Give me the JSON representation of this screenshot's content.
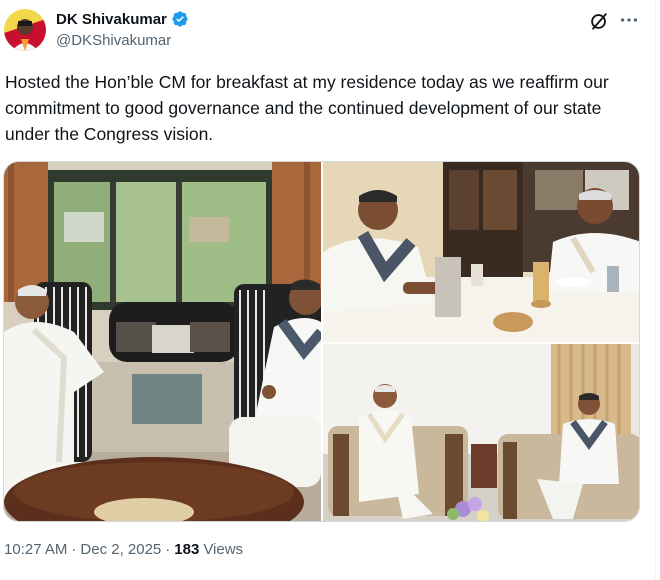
{
  "author": {
    "display_name": "DK Shivakumar",
    "handle": "@DKShivakumar",
    "verified_icon": "verified-badge-icon",
    "avatar": "avatar"
  },
  "actions": {
    "grok_icon": "grok-icon",
    "more_icon": "more-dots-icon"
  },
  "tweet": {
    "text": "Hosted the Hon’ble CM for breakfast at my residence today as we reaffirm our commitment to good governance and the continued development of our state under the Congress vision."
  },
  "media": {
    "count": 3
  },
  "meta": {
    "time": "10:27 AM",
    "separator": "·",
    "date": "Dec 2, 2025",
    "separator2": "·",
    "views_count": "183",
    "views_label": "Views"
  },
  "colors": {
    "text": "#0f1419",
    "secondary": "#536471",
    "verified": "#1d9bf0",
    "border": "#cfd9de"
  }
}
